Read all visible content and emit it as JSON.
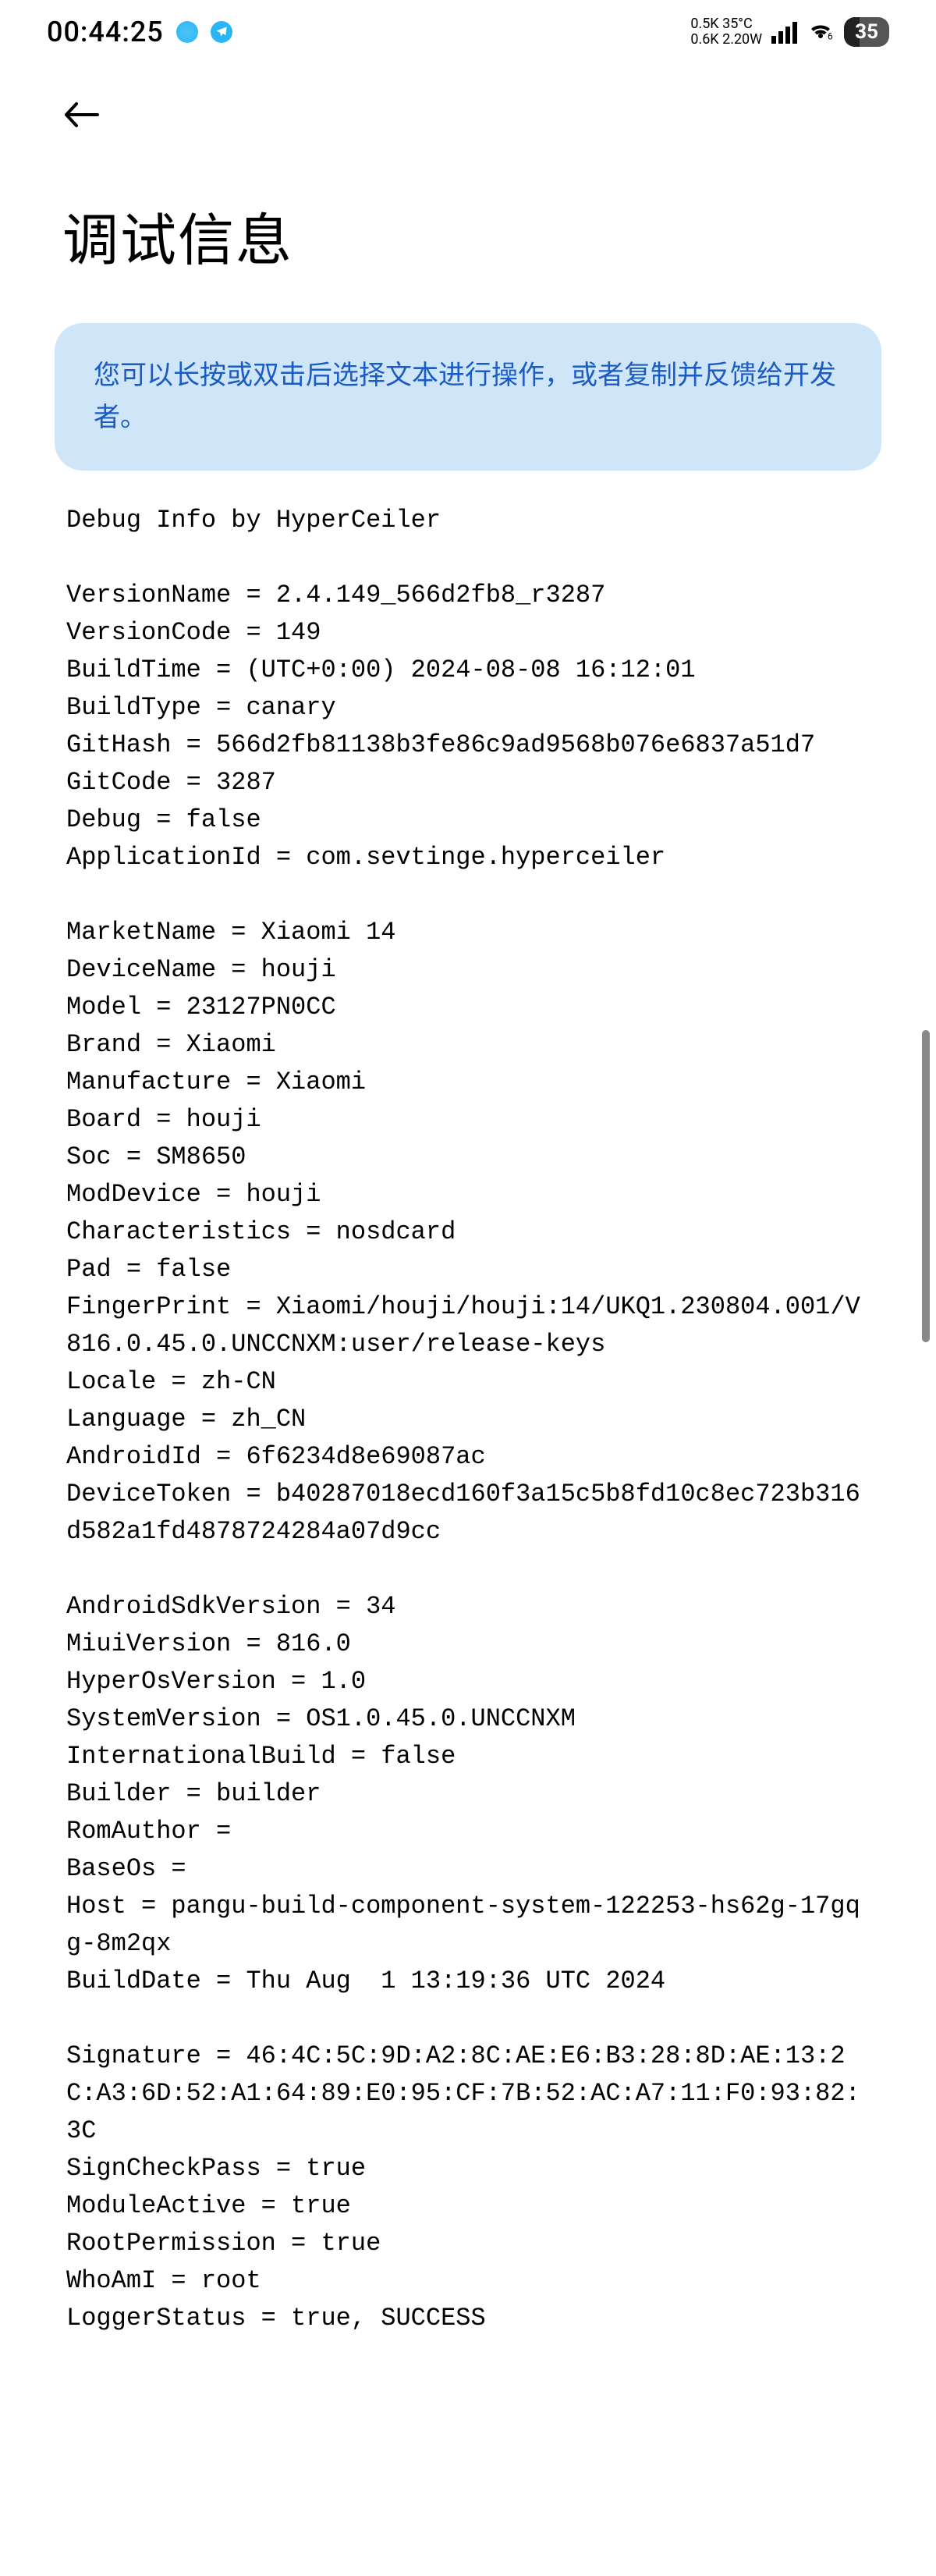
{
  "statusBar": {
    "time": "00:44:25",
    "netSpeed1": "0.5K",
    "temp": "35°C",
    "netSpeed2": "0.6K",
    "power": "2.20W",
    "battery": "35"
  },
  "header": {
    "title": "调试信息"
  },
  "banner": {
    "text": "您可以长按或双击后选择文本进行操作，或者复制并反馈给开发者。"
  },
  "debugInfo": {
    "content": "Debug Info by HyperCeiler\n\nVersionName = 2.4.149_566d2fb8_r3287\nVersionCode = 149\nBuildTime = (UTC+0:00) 2024-08-08 16:12:01\nBuildType = canary\nGitHash = 566d2fb81138b3fe86c9ad9568b076e6837a51d7\nGitCode = 3287\nDebug = false\nApplicationId = com.sevtinge.hyperceiler\n\nMarketName = Xiaomi 14\nDeviceName = houji\nModel = 23127PN0CC\nBrand = Xiaomi\nManufacture = Xiaomi\nBoard = houji\nSoc = SM8650\nModDevice = houji\nCharacteristics = nosdcard\nPad = false\nFingerPrint = Xiaomi/houji/houji:14/UKQ1.230804.001/V816.0.45.0.UNCCNXM:user/release-keys\nLocale = zh-CN\nLanguage = zh_CN\nAndroidId = 6f6234d8e69087ac\nDeviceToken = b40287018ecd160f3a15c5b8fd10c8ec723b316d582a1fd4878724284a07d9cc\n\nAndroidSdkVersion = 34\nMiuiVersion = 816.0\nHyperOsVersion = 1.0\nSystemVersion = OS1.0.45.0.UNCCNXM\nInternationalBuild = false\nBuilder = builder\nRomAuthor = \nBaseOs = \nHost = pangu-build-component-system-122253-hs62g-17gqg-8m2qx\nBuildDate = Thu Aug  1 13:19:36 UTC 2024\n\nSignature = 46:4C:5C:9D:A2:8C:AE:E6:B3:28:8D:AE:13:2C:A3:6D:52:A1:64:89:E0:95:CF:7B:52:AC:A7:11:F0:93:82:3C\nSignCheckPass = true\nModuleActive = true\nRootPermission = true\nWhoAmI = root\nLoggerStatus = true, SUCCESS"
  }
}
